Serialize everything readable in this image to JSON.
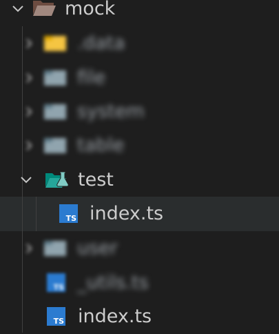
{
  "explorer": {
    "root": {
      "label": "mock",
      "expanded": true,
      "icon": "folder-open-icon"
    },
    "items": [
      {
        "label": ".data",
        "type": "folder",
        "blurred": true,
        "icon": "folder-yellow-icon"
      },
      {
        "label": "file",
        "type": "folder",
        "blurred": true,
        "icon": "folder-icon"
      },
      {
        "label": "system",
        "type": "folder",
        "blurred": true,
        "icon": "folder-icon"
      },
      {
        "label": "table",
        "type": "folder",
        "blurred": true,
        "icon": "folder-icon"
      },
      {
        "label": "test",
        "type": "folder",
        "expanded": true,
        "icon": "folder-test-icon"
      },
      {
        "label": "index.ts",
        "type": "file",
        "selected": true,
        "icon": "typescript-icon"
      },
      {
        "label": "user",
        "type": "folder",
        "blurred": true,
        "icon": "folder-icon"
      },
      {
        "label": "_utils.ts",
        "type": "file",
        "blurred": true,
        "icon": "typescript-icon"
      },
      {
        "label": "index.ts",
        "type": "file",
        "icon": "typescript-icon"
      }
    ]
  },
  "colors": {
    "background": "#1e1e1e",
    "selected_row": "#2a2d2e",
    "text": "#cccccc",
    "ts_badge": "#2b7bd0",
    "folder_test": "#26a69a",
    "folder_default": "#90a4ae",
    "folder_yellow": "#f5c542",
    "folder_root": "#8d6e63"
  }
}
